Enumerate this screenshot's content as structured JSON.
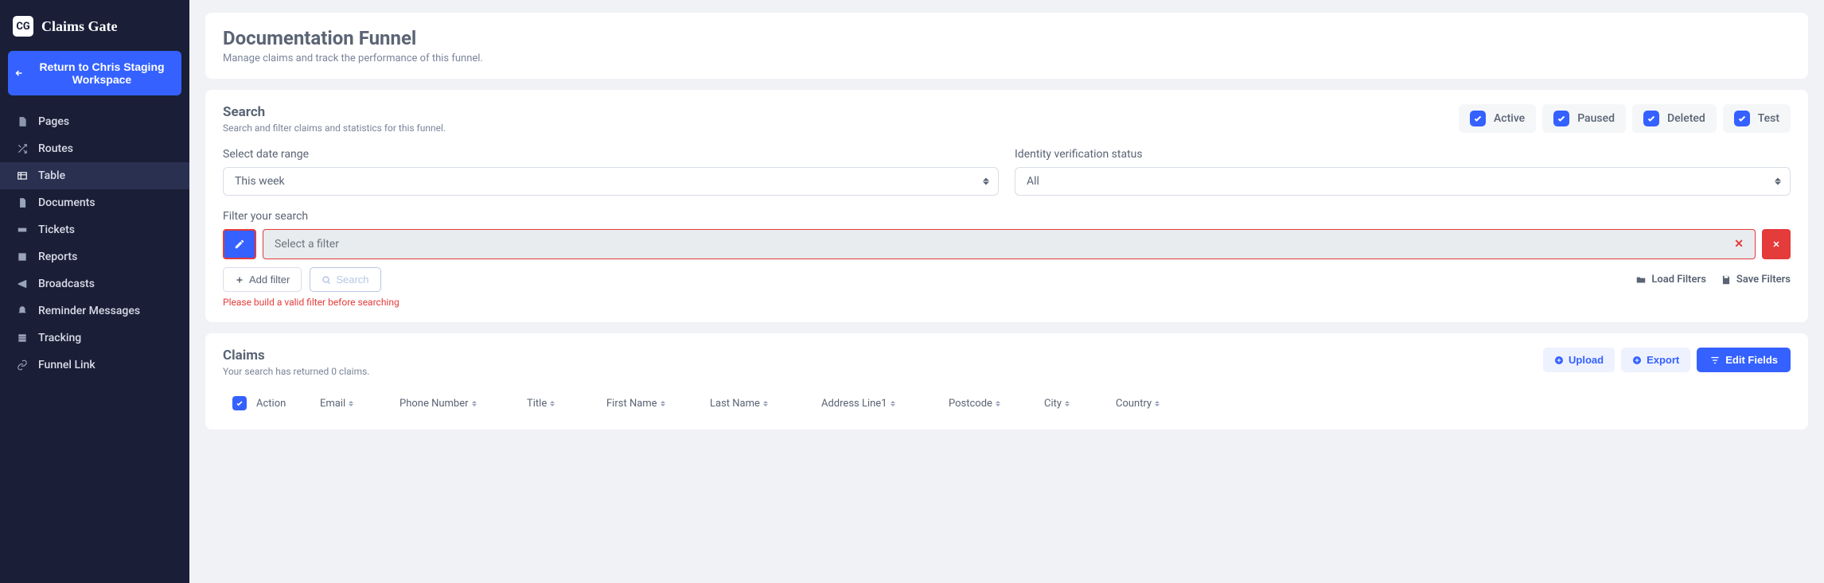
{
  "brand": {
    "badge": "CG",
    "name": "Claims Gate"
  },
  "return_button": "Return to Chris Staging Workspace",
  "nav": [
    {
      "label": "Pages",
      "icon": "file"
    },
    {
      "label": "Routes",
      "icon": "shuffle"
    },
    {
      "label": "Table",
      "icon": "table",
      "active": true
    },
    {
      "label": "Documents",
      "icon": "doc"
    },
    {
      "label": "Tickets",
      "icon": "ticket"
    },
    {
      "label": "Reports",
      "icon": "report"
    },
    {
      "label": "Broadcasts",
      "icon": "broadcast"
    },
    {
      "label": "Reminder Messages",
      "icon": "bell"
    },
    {
      "label": "Tracking",
      "icon": "tracking"
    },
    {
      "label": "Funnel Link",
      "icon": "link"
    }
  ],
  "header": {
    "title": "Documentation Funnel",
    "subtitle": "Manage claims and track the performance of this funnel."
  },
  "search": {
    "title": "Search",
    "subtitle": "Search and filter claims and statistics for this funnel.",
    "statuses": [
      {
        "label": "Active",
        "checked": true
      },
      {
        "label": "Paused",
        "checked": true
      },
      {
        "label": "Deleted",
        "checked": true
      },
      {
        "label": "Test",
        "checked": true
      }
    ],
    "date_range": {
      "label": "Select date range",
      "value": "This week"
    },
    "identity": {
      "label": "Identity verification status",
      "value": "All"
    },
    "filter": {
      "label": "Filter your search",
      "placeholder": "Select a filter"
    },
    "add_filter": "Add filter",
    "search_btn": "Search",
    "load_filters": "Load Filters",
    "save_filters": "Save Filters",
    "error": "Please build a valid filter before searching"
  },
  "claims": {
    "title": "Claims",
    "subtitle": "Your search has returned 0 claims.",
    "upload": "Upload",
    "export": "Export",
    "edit_fields": "Edit Fields",
    "columns": [
      "Action",
      "Email",
      "Phone Number",
      "Title",
      "First Name",
      "Last Name",
      "Address Line1",
      "Postcode",
      "City",
      "Country"
    ]
  }
}
